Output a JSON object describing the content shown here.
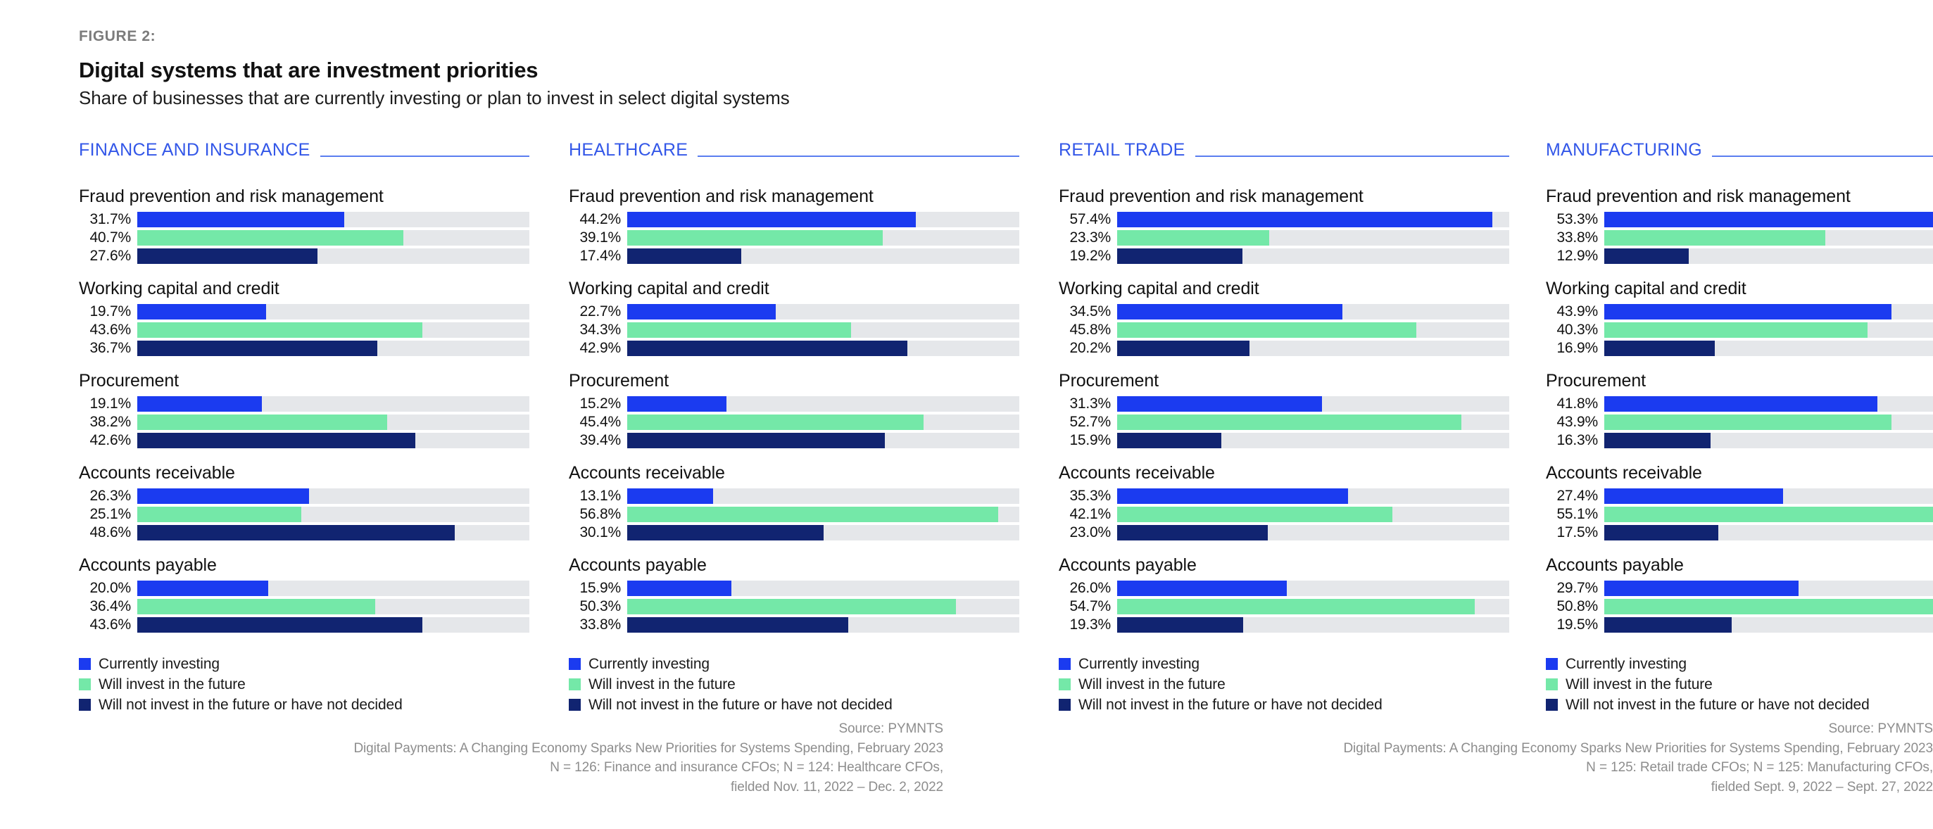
{
  "header": {
    "figure_label": "FIGURE 2:",
    "title": "Digital systems that are investment priorities",
    "subtitle": "Share of businesses that are currently investing or plan to invest in select digital systems"
  },
  "legend": {
    "items": [
      {
        "label": "Currently investing",
        "color": "#1b3bf0"
      },
      {
        "label": "Will invest in the future",
        "color": "#74e8a8"
      },
      {
        "label": "Will not invest in the future or have not decided",
        "color": "#112471"
      }
    ]
  },
  "sources": {
    "left": [
      "Source: PYMNTS",
      "Digital Payments: A Changing Economy Sparks New Priorities for Systems Spending, February 2023",
      "N = 126: Finance and insurance CFOs; N = 124: Healthcare CFOs,",
      "fielded Nov. 11, 2022 – Dec. 2, 2022"
    ],
    "right": [
      "Source: PYMNTS",
      "Digital Payments: A Changing Economy Sparks New Priorities for Systems Spending, February 2023",
      "N = 125: Retail trade CFOs; N = 125: Manufacturing CFOs,",
      "fielded Sept. 9, 2022 – Sept. 27, 2022"
    ]
  },
  "chart_data": {
    "type": "bar",
    "title": "Digital systems that are investment priorities",
    "subtitle": "Share of businesses that are currently investing or plan to invest in select digital systems",
    "xlabel": "",
    "ylabel": "",
    "xlim": [
      0,
      60
    ],
    "grid": false,
    "legend_position": "bottom-left",
    "value_format": "percent-one-decimal",
    "series_names": [
      "Currently investing",
      "Will invest in the future",
      "Will not invest in the future or have not decided"
    ],
    "series_colors": [
      "#1b3bf0",
      "#74e8a8",
      "#112471"
    ],
    "categories": [
      "Fraud prevention and risk management",
      "Working capital and credit",
      "Procurement",
      "Accounts receivable",
      "Accounts payable"
    ],
    "panels": [
      {
        "name": "FINANCE AND INSURANCE",
        "groups": [
          {
            "label": "Fraud prevention and risk management",
            "rows": [
              {
                "series": "Currently investing",
                "value": 31.7,
                "text": "31.7%"
              },
              {
                "series": "Will invest in the future",
                "value": 40.7,
                "text": "40.7%"
              },
              {
                "series": "Will not invest in the future or have not decided",
                "value": 27.6,
                "text": "27.6%"
              }
            ]
          },
          {
            "label": "Working capital and credit",
            "rows": [
              {
                "series": "Currently investing",
                "value": 19.7,
                "text": "19.7%"
              },
              {
                "series": "Will invest in the future",
                "value": 43.6,
                "text": "43.6%"
              },
              {
                "series": "Will not invest in the future or have not decided",
                "value": 36.7,
                "text": "36.7%"
              }
            ]
          },
          {
            "label": "Procurement",
            "rows": [
              {
                "series": "Currently investing",
                "value": 19.1,
                "text": "19.1%"
              },
              {
                "series": "Will invest in the future",
                "value": 38.2,
                "text": "38.2%"
              },
              {
                "series": "Will not invest in the future or have not decided",
                "value": 42.6,
                "text": "42.6%"
              }
            ]
          },
          {
            "label": "Accounts receivable",
            "rows": [
              {
                "series": "Currently investing",
                "value": 26.3,
                "text": "26.3%"
              },
              {
                "series": "Will invest in the future",
                "value": 25.1,
                "text": "25.1%"
              },
              {
                "series": "Will not invest in the future or have not decided",
                "value": 48.6,
                "text": "48.6%"
              }
            ]
          },
          {
            "label": "Accounts payable",
            "rows": [
              {
                "series": "Currently investing",
                "value": 20.0,
                "text": "20.0%"
              },
              {
                "series": "Will invest in the future",
                "value": 36.4,
                "text": "36.4%"
              },
              {
                "series": "Will not invest in the future or have not decided",
                "value": 43.6,
                "text": "43.6%"
              }
            ]
          }
        ]
      },
      {
        "name": "HEALTHCARE",
        "groups": [
          {
            "label": "Fraud prevention and risk management",
            "rows": [
              {
                "series": "Currently investing",
                "value": 44.2,
                "text": "44.2%"
              },
              {
                "series": "Will invest in the future",
                "value": 39.1,
                "text": "39.1%"
              },
              {
                "series": "Will not invest in the future or have not decided",
                "value": 17.4,
                "text": "17.4%"
              }
            ]
          },
          {
            "label": "Working capital and credit",
            "rows": [
              {
                "series": "Currently investing",
                "value": 22.7,
                "text": "22.7%"
              },
              {
                "series": "Will invest in the future",
                "value": 34.3,
                "text": "34.3%"
              },
              {
                "series": "Will not invest in the future or have not decided",
                "value": 42.9,
                "text": "42.9%"
              }
            ]
          },
          {
            "label": "Procurement",
            "rows": [
              {
                "series": "Currently investing",
                "value": 15.2,
                "text": "15.2%"
              },
              {
                "series": "Will invest in the future",
                "value": 45.4,
                "text": "45.4%"
              },
              {
                "series": "Will not invest in the future or have not decided",
                "value": 39.4,
                "text": "39.4%"
              }
            ]
          },
          {
            "label": "Accounts receivable",
            "rows": [
              {
                "series": "Currently investing",
                "value": 13.1,
                "text": "13.1%"
              },
              {
                "series": "Will invest in the future",
                "value": 56.8,
                "text": "56.8%"
              },
              {
                "series": "Will not invest in the future or have not decided",
                "value": 30.1,
                "text": "30.1%"
              }
            ]
          },
          {
            "label": "Accounts payable",
            "rows": [
              {
                "series": "Currently investing",
                "value": 15.9,
                "text": "15.9%"
              },
              {
                "series": "Will invest in the future",
                "value": 50.3,
                "text": "50.3%"
              },
              {
                "series": "Will not invest in the future or have not decided",
                "value": 33.8,
                "text": "33.8%"
              }
            ]
          }
        ]
      },
      {
        "name": "RETAIL TRADE",
        "groups": [
          {
            "label": "Fraud prevention and risk management",
            "rows": [
              {
                "series": "Currently investing",
                "value": 57.4,
                "text": "57.4%"
              },
              {
                "series": "Will invest in the future",
                "value": 23.3,
                "text": "23.3%"
              },
              {
                "series": "Will not invest in the future or have not decided",
                "value": 19.2,
                "text": "19.2%"
              }
            ]
          },
          {
            "label": "Working capital and credit",
            "rows": [
              {
                "series": "Currently investing",
                "value": 34.5,
                "text": "34.5%"
              },
              {
                "series": "Will invest in the future",
                "value": 45.8,
                "text": "45.8%"
              },
              {
                "series": "Will not invest in the future or have not decided",
                "value": 20.2,
                "text": "20.2%"
              }
            ]
          },
          {
            "label": "Procurement",
            "rows": [
              {
                "series": "Currently investing",
                "value": 31.3,
                "text": "31.3%"
              },
              {
                "series": "Will invest in the future",
                "value": 52.7,
                "text": "52.7%"
              },
              {
                "series": "Will not invest in the future or have not decided",
                "value": 15.9,
                "text": "15.9%"
              }
            ]
          },
          {
            "label": "Accounts receivable",
            "rows": [
              {
                "series": "Currently investing",
                "value": 35.3,
                "text": "35.3%"
              },
              {
                "series": "Will invest in the future",
                "value": 42.1,
                "text": "42.1%"
              },
              {
                "series": "Will not invest in the future or have not decided",
                "value": 23.0,
                "text": "23.0%"
              }
            ]
          },
          {
            "label": "Accounts payable",
            "rows": [
              {
                "series": "Currently investing",
                "value": 26.0,
                "text": "26.0%"
              },
              {
                "series": "Will invest in the future",
                "value": 54.7,
                "text": "54.7%"
              },
              {
                "series": "Will not invest in the future or have not decided",
                "value": 19.3,
                "text": "19.3%"
              }
            ]
          }
        ]
      },
      {
        "name": "MANUFACTURING",
        "groups": [
          {
            "label": "Fraud prevention and risk management",
            "rows": [
              {
                "series": "Currently investing",
                "value": 53.3,
                "text": "53.3%"
              },
              {
                "series": "Will invest in the future",
                "value": 33.8,
                "text": "33.8%"
              },
              {
                "series": "Will not invest in the future or have not decided",
                "value": 12.9,
                "text": "12.9%"
              }
            ]
          },
          {
            "label": "Working capital and credit",
            "rows": [
              {
                "series": "Currently investing",
                "value": 43.9,
                "text": "43.9%"
              },
              {
                "series": "Will invest in the future",
                "value": 40.3,
                "text": "40.3%"
              },
              {
                "series": "Will not invest in the future or have not decided",
                "value": 16.9,
                "text": "16.9%"
              }
            ]
          },
          {
            "label": "Procurement",
            "rows": [
              {
                "series": "Currently investing",
                "value": 41.8,
                "text": "41.8%"
              },
              {
                "series": "Will invest in the future",
                "value": 43.9,
                "text": "43.9%"
              },
              {
                "series": "Will not invest in the future or have not decided",
                "value": 16.3,
                "text": "16.3%"
              }
            ]
          },
          {
            "label": "Accounts receivable",
            "rows": [
              {
                "series": "Currently investing",
                "value": 27.4,
                "text": "27.4%"
              },
              {
                "series": "Will invest in the future",
                "value": 55.1,
                "text": "55.1%"
              },
              {
                "series": "Will not invest in the future or have not decided",
                "value": 17.5,
                "text": "17.5%"
              }
            ]
          },
          {
            "label": "Accounts payable",
            "rows": [
              {
                "series": "Currently investing",
                "value": 29.7,
                "text": "29.7%"
              },
              {
                "series": "Will invest in the future",
                "value": 50.8,
                "text": "50.8%"
              },
              {
                "series": "Will not invest in the future or have not decided",
                "value": 19.5,
                "text": "19.5%"
              }
            ]
          }
        ]
      }
    ]
  }
}
